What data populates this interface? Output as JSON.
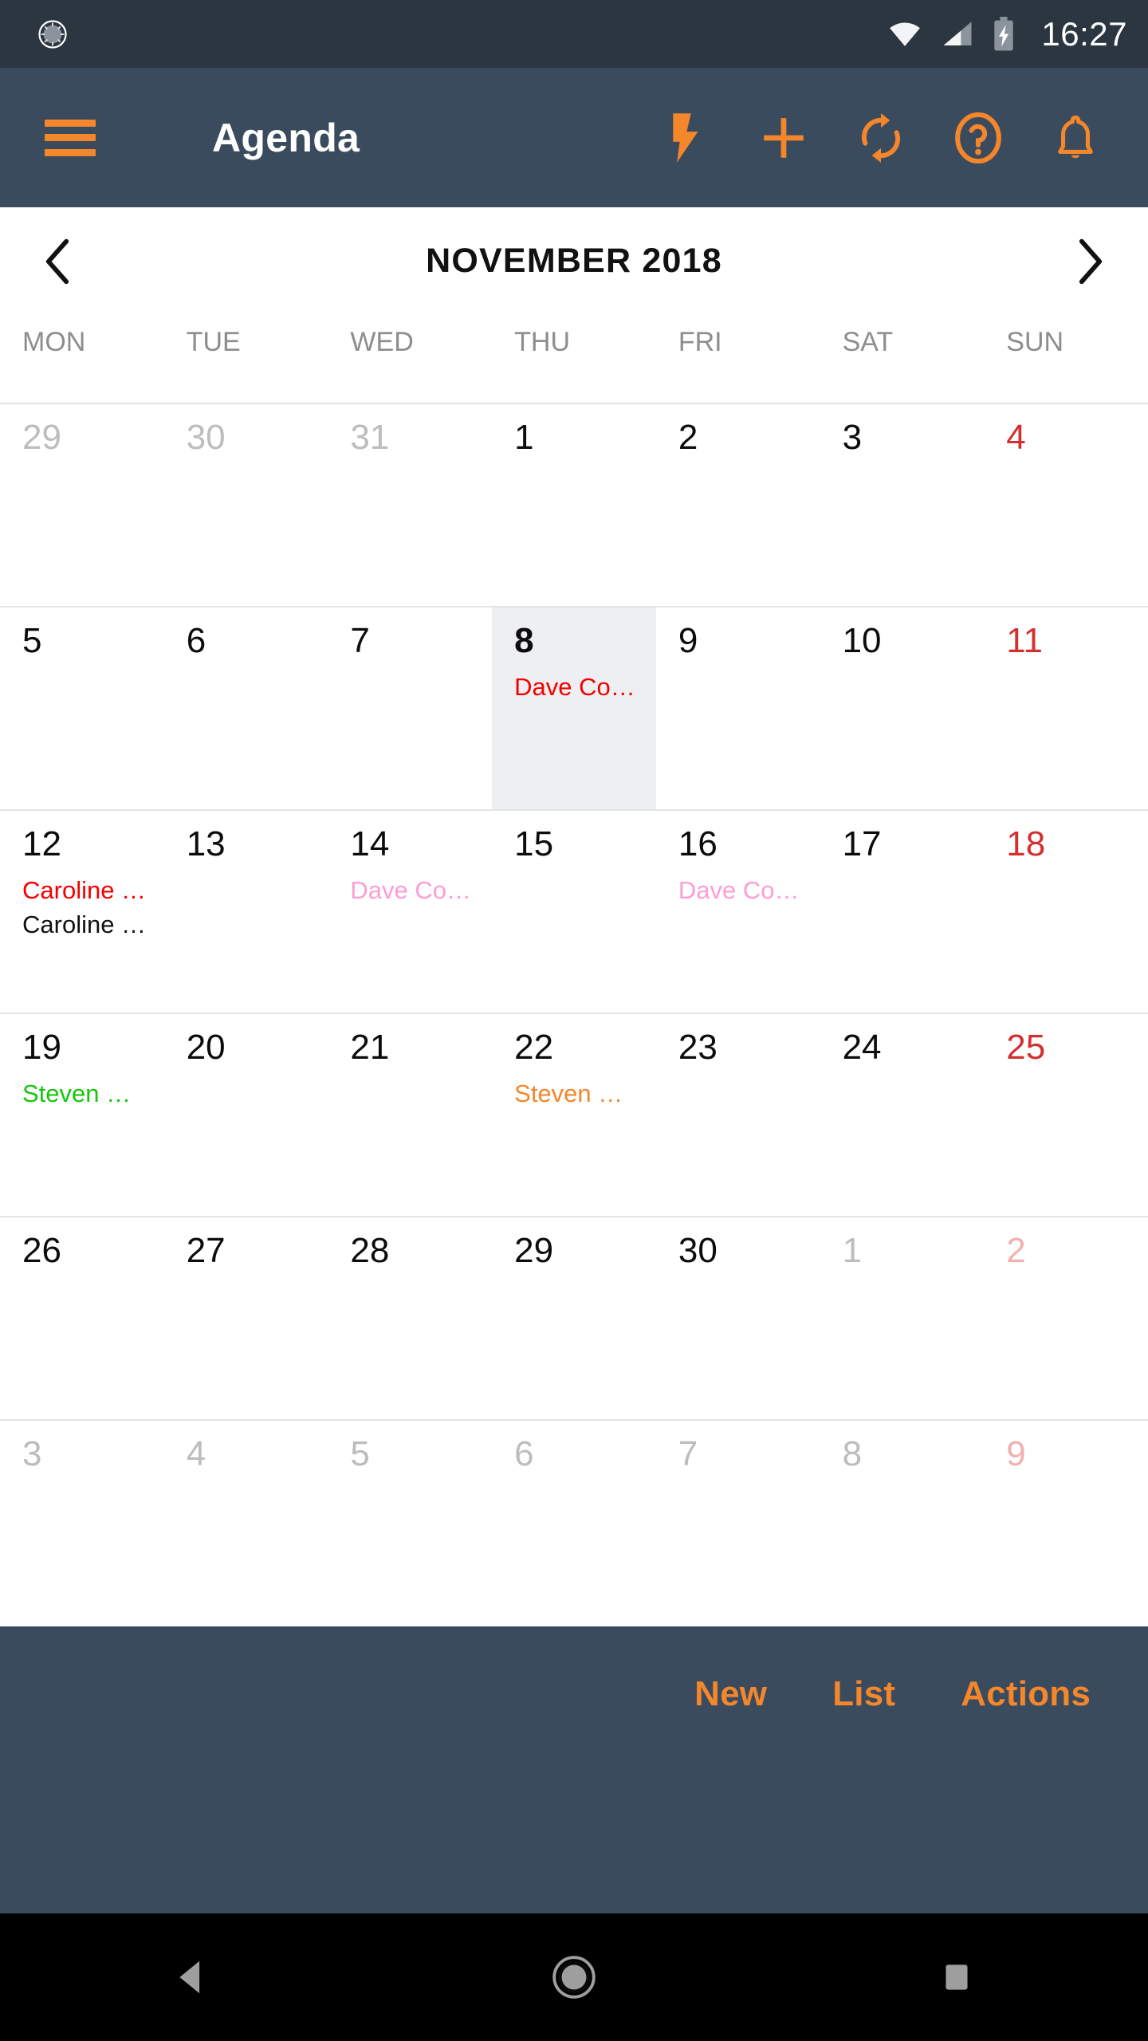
{
  "statusbar": {
    "time": "16:27",
    "icons": [
      "notification-sync-icon",
      "wifi-icon",
      "signal-icon",
      "battery-charging-icon"
    ]
  },
  "toolbar": {
    "menu_icon": "hamburger-menu-icon",
    "title": "Agenda",
    "actions": [
      {
        "name": "quick-action-icon",
        "icon": "lightning-bolt-icon"
      },
      {
        "name": "add-icon",
        "icon": "plus-icon"
      },
      {
        "name": "sync-icon",
        "icon": "refresh-sync-icon"
      },
      {
        "name": "help-icon",
        "icon": "question-circle-icon"
      },
      {
        "name": "notifications-icon",
        "icon": "bell-icon"
      }
    ]
  },
  "month_nav": {
    "prev_icon": "chevron-left-icon",
    "next_icon": "chevron-right-icon",
    "title": "NOVEMBER 2018"
  },
  "weekdays": [
    "MON",
    "TUE",
    "WED",
    "THU",
    "FRI",
    "SAT",
    "SUN"
  ],
  "colors": {
    "statusbar_bg": "#2b3641",
    "toolbar_bg": "#3a4b5e",
    "accent_orange": "#f4862b",
    "today_bg": "#eeeff2",
    "sunday_red": "#d32f2f",
    "outside_gray": "#bdbdbd",
    "grid_line": "#e4e4e4"
  },
  "calendar": {
    "weeks": [
      [
        {
          "day": "29",
          "outside": true,
          "sunday": false,
          "today": false,
          "events": []
        },
        {
          "day": "30",
          "outside": true,
          "sunday": false,
          "today": false,
          "events": []
        },
        {
          "day": "31",
          "outside": true,
          "sunday": false,
          "today": false,
          "events": []
        },
        {
          "day": "1",
          "outside": false,
          "sunday": false,
          "today": false,
          "events": []
        },
        {
          "day": "2",
          "outside": false,
          "sunday": false,
          "today": false,
          "events": []
        },
        {
          "day": "3",
          "outside": false,
          "sunday": false,
          "today": false,
          "events": []
        },
        {
          "day": "4",
          "outside": false,
          "sunday": true,
          "today": false,
          "events": []
        }
      ],
      [
        {
          "day": "5",
          "outside": false,
          "sunday": false,
          "today": false,
          "events": []
        },
        {
          "day": "6",
          "outside": false,
          "sunday": false,
          "today": false,
          "events": []
        },
        {
          "day": "7",
          "outside": false,
          "sunday": false,
          "today": false,
          "events": []
        },
        {
          "day": "8",
          "outside": false,
          "sunday": false,
          "today": true,
          "events": [
            {
              "label": "Dave Co…",
              "color": "#f50000"
            }
          ]
        },
        {
          "day": "9",
          "outside": false,
          "sunday": false,
          "today": false,
          "events": []
        },
        {
          "day": "10",
          "outside": false,
          "sunday": false,
          "today": false,
          "events": []
        },
        {
          "day": "11",
          "outside": false,
          "sunday": true,
          "today": false,
          "events": []
        }
      ],
      [
        {
          "day": "12",
          "outside": false,
          "sunday": false,
          "today": false,
          "events": [
            {
              "label": "Caroline …",
              "color": "#f50000"
            },
            {
              "label": "Caroline …",
              "color": "#111111"
            }
          ]
        },
        {
          "day": "13",
          "outside": false,
          "sunday": false,
          "today": false,
          "events": []
        },
        {
          "day": "14",
          "outside": false,
          "sunday": false,
          "today": false,
          "events": [
            {
              "label": "Dave Co…",
              "color": "#ff9cd4"
            }
          ]
        },
        {
          "day": "15",
          "outside": false,
          "sunday": false,
          "today": false,
          "events": []
        },
        {
          "day": "16",
          "outside": false,
          "sunday": false,
          "today": false,
          "events": [
            {
              "label": "Dave Co…",
              "color": "#ff9cd4"
            }
          ]
        },
        {
          "day": "17",
          "outside": false,
          "sunday": false,
          "today": false,
          "events": []
        },
        {
          "day": "18",
          "outside": false,
          "sunday": true,
          "today": false,
          "events": []
        }
      ],
      [
        {
          "day": "19",
          "outside": false,
          "sunday": false,
          "today": false,
          "events": [
            {
              "label": "Steven …",
              "color": "#16c60c"
            }
          ]
        },
        {
          "day": "20",
          "outside": false,
          "sunday": false,
          "today": false,
          "events": []
        },
        {
          "day": "21",
          "outside": false,
          "sunday": false,
          "today": false,
          "events": []
        },
        {
          "day": "22",
          "outside": false,
          "sunday": false,
          "today": false,
          "events": [
            {
              "label": "Steven …",
              "color": "#f4862b"
            }
          ]
        },
        {
          "day": "23",
          "outside": false,
          "sunday": false,
          "today": false,
          "events": []
        },
        {
          "day": "24",
          "outside": false,
          "sunday": false,
          "today": false,
          "events": []
        },
        {
          "day": "25",
          "outside": false,
          "sunday": true,
          "today": false,
          "events": []
        }
      ],
      [
        {
          "day": "26",
          "outside": false,
          "sunday": false,
          "today": false,
          "events": []
        },
        {
          "day": "27",
          "outside": false,
          "sunday": false,
          "today": false,
          "events": []
        },
        {
          "day": "28",
          "outside": false,
          "sunday": false,
          "today": false,
          "events": []
        },
        {
          "day": "29",
          "outside": false,
          "sunday": false,
          "today": false,
          "events": []
        },
        {
          "day": "30",
          "outside": false,
          "sunday": false,
          "today": false,
          "events": []
        },
        {
          "day": "1",
          "outside": true,
          "sunday": false,
          "today": false,
          "events": []
        },
        {
          "day": "2",
          "outside": true,
          "sunday": true,
          "today": false,
          "events": []
        }
      ],
      [
        {
          "day": "3",
          "outside": true,
          "sunday": false,
          "today": false,
          "events": []
        },
        {
          "day": "4",
          "outside": true,
          "sunday": false,
          "today": false,
          "events": []
        },
        {
          "day": "5",
          "outside": true,
          "sunday": false,
          "today": false,
          "events": []
        },
        {
          "day": "6",
          "outside": true,
          "sunday": false,
          "today": false,
          "events": []
        },
        {
          "day": "7",
          "outside": true,
          "sunday": false,
          "today": false,
          "events": []
        },
        {
          "day": "8",
          "outside": true,
          "sunday": false,
          "today": false,
          "events": []
        },
        {
          "day": "9",
          "outside": true,
          "sunday": true,
          "today": false,
          "events": []
        }
      ]
    ]
  },
  "bottom_bar": {
    "buttons": [
      {
        "name": "new-button",
        "label": "New"
      },
      {
        "name": "list-button",
        "label": "List"
      },
      {
        "name": "actions-button",
        "label": "Actions"
      }
    ]
  },
  "navbar": {
    "back_icon": "back-triangle-icon",
    "home_icon": "home-circle-icon",
    "recents_icon": "recents-square-icon"
  }
}
